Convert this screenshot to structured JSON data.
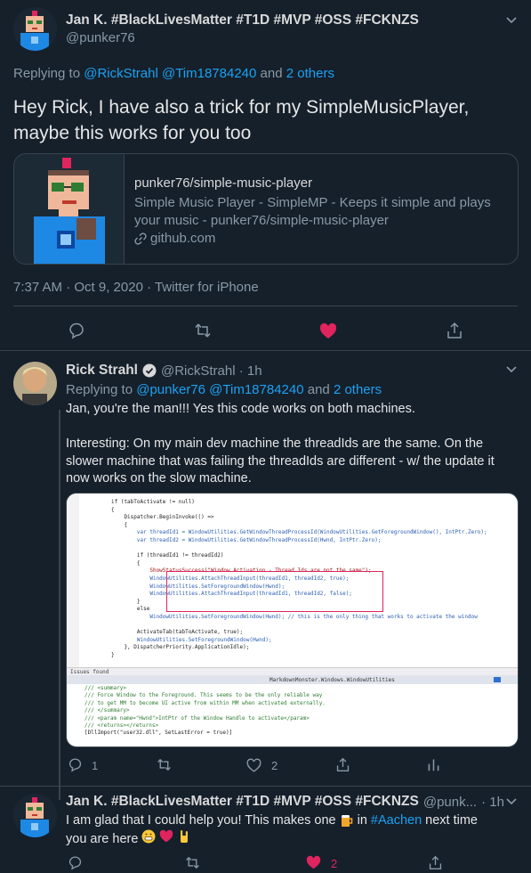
{
  "tweet1": {
    "name": "Jan K. #BlackLivesMatter #T1D #MVP #OSS #FCKNZS",
    "handle": "@punker76",
    "replying_prefix": "Replying to",
    "replying_users": "@RickStrahl @Tim18784240",
    "replying_and": "and",
    "replying_others": "2 others",
    "text_line1": "Hey Rick, I have also a trick for my SimpleMusicPlayer,",
    "text_line2": "maybe this works for you too",
    "card": {
      "title": "punker76/simple-music-player",
      "desc_line1": "Simple Music Player - SimpleMP - Keeps it simple and plays",
      "desc_line2": "your music - punker76/simple-music-player",
      "domain": "github.com"
    },
    "timestamp": "7:37 AM · Oct 9, 2020 · Twitter for iPhone"
  },
  "tweet2": {
    "name": "Rick Strahl",
    "handle": "@RickStrahl · 1h",
    "replying_prefix": "Replying to",
    "replying_users": "@punker76 @Tim18784240",
    "replying_and": "and",
    "replying_others": "2 others",
    "text_line1": "Jan, you're the man!!! Yes this code works on both machines.",
    "text_line2": "Interesting: On my main dev machine the threadIds are the same. On the",
    "text_line3": "slower machine that was failing the threadIds are different - w/ the update it",
    "text_line4": "now works on the slow machine.",
    "reply_count": "1",
    "like_count": "2",
    "code_lines": [
      "if (tabToActivate != null)",
      "{",
      "    Dispatcher.BeginInvoke(() =>",
      "    {",
      "        var threadId1 = WindowUtilities.GetWindowThreadProcessId(WindowUtilities.GetForegroundWindow(), IntPtr.Zero);",
      "        var threadId2 = WindowUtilities.GetWindowThreadProcessId(Hwnd, IntPtr.Zero);",
      "",
      "        if (threadId1 != threadId2)",
      "        {",
      "            ShowStatusSuccess(\"Window Activation - Thread Ids are not the same\");",
      "            WindowUtilities.AttachThreadInput(threadId1, threadId2, true);",
      "            WindowUtilities.SetForegroundWindow(Hwnd);",
      "            WindowUtilities.AttachThreadInput(threadId1, threadId2, false);",
      "        }",
      "        else",
      "            WindowUtilities.SetForegroundWindow(Hwnd); // this is the only thing that works to activate the window",
      "",
      "        ActivateTab(tabToActivate, true);",
      "        WindowUtilities.SetForegroundWindow(Hwnd);",
      "    }, DispatcherPriority.ApplicationIdle);",
      "}"
    ],
    "panel_tab": "Issues found",
    "panel_path": "MarkdownMonster.Windows.WindowUtilities",
    "panel_lines": [
      "/// <summary>",
      "/// Force Window to the Foreground. This seems to be the only reliable way",
      "/// to get MM to become UI active from within MM when activated externally.",
      "/// </summary>",
      "/// <param name=\"Hwnd\">IntPtr of the Window Handle to activate</param>",
      "/// <returns></returns>",
      "[DllImport(\"user32.dll\", SetLastError = true)]"
    ]
  },
  "tweet3": {
    "name": "Jan K. #BlackLivesMatter #T1D #MVP #OSS #FCKNZS",
    "handle": "@punk...",
    "time": "· 1h",
    "text_part1": "I am glad that I could help you! This makes one",
    "text_part2": "in",
    "hashtag": "#Aachen",
    "text_part3": "next time",
    "text_line2": "you are here",
    "like_count": "2"
  },
  "colors": {
    "background": "#15202b",
    "link": "#1da1f2",
    "like": "#e0245e",
    "muted": "#8899a6",
    "divider": "#38444d"
  }
}
